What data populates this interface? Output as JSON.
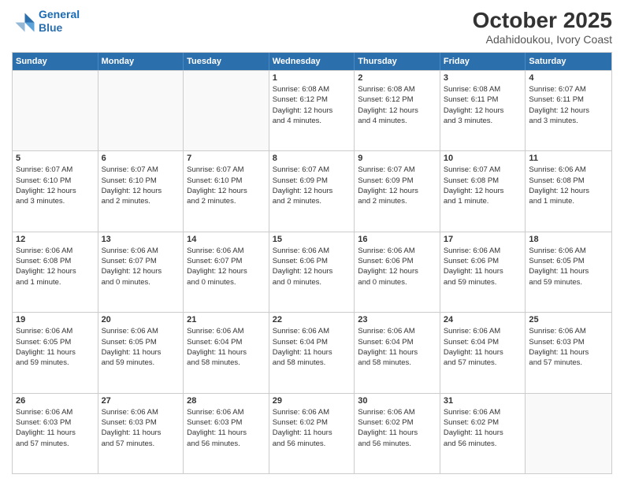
{
  "header": {
    "logo_line1": "General",
    "logo_line2": "Blue",
    "month": "October 2025",
    "location": "Adahidoukou, Ivory Coast"
  },
  "days_of_week": [
    "Sunday",
    "Monday",
    "Tuesday",
    "Wednesday",
    "Thursday",
    "Friday",
    "Saturday"
  ],
  "rows": [
    [
      {
        "day": "",
        "info": [],
        "empty": true
      },
      {
        "day": "",
        "info": [],
        "empty": true
      },
      {
        "day": "",
        "info": [],
        "empty": true
      },
      {
        "day": "1",
        "info": [
          "Sunrise: 6:08 AM",
          "Sunset: 6:12 PM",
          "Daylight: 12 hours",
          "and 4 minutes."
        ],
        "empty": false
      },
      {
        "day": "2",
        "info": [
          "Sunrise: 6:08 AM",
          "Sunset: 6:12 PM",
          "Daylight: 12 hours",
          "and 4 minutes."
        ],
        "empty": false
      },
      {
        "day": "3",
        "info": [
          "Sunrise: 6:08 AM",
          "Sunset: 6:11 PM",
          "Daylight: 12 hours",
          "and 3 minutes."
        ],
        "empty": false
      },
      {
        "day": "4",
        "info": [
          "Sunrise: 6:07 AM",
          "Sunset: 6:11 PM",
          "Daylight: 12 hours",
          "and 3 minutes."
        ],
        "empty": false
      }
    ],
    [
      {
        "day": "5",
        "info": [
          "Sunrise: 6:07 AM",
          "Sunset: 6:10 PM",
          "Daylight: 12 hours",
          "and 3 minutes."
        ],
        "empty": false
      },
      {
        "day": "6",
        "info": [
          "Sunrise: 6:07 AM",
          "Sunset: 6:10 PM",
          "Daylight: 12 hours",
          "and 2 minutes."
        ],
        "empty": false
      },
      {
        "day": "7",
        "info": [
          "Sunrise: 6:07 AM",
          "Sunset: 6:10 PM",
          "Daylight: 12 hours",
          "and 2 minutes."
        ],
        "empty": false
      },
      {
        "day": "8",
        "info": [
          "Sunrise: 6:07 AM",
          "Sunset: 6:09 PM",
          "Daylight: 12 hours",
          "and 2 minutes."
        ],
        "empty": false
      },
      {
        "day": "9",
        "info": [
          "Sunrise: 6:07 AM",
          "Sunset: 6:09 PM",
          "Daylight: 12 hours",
          "and 2 minutes."
        ],
        "empty": false
      },
      {
        "day": "10",
        "info": [
          "Sunrise: 6:07 AM",
          "Sunset: 6:08 PM",
          "Daylight: 12 hours",
          "and 1 minute."
        ],
        "empty": false
      },
      {
        "day": "11",
        "info": [
          "Sunrise: 6:06 AM",
          "Sunset: 6:08 PM",
          "Daylight: 12 hours",
          "and 1 minute."
        ],
        "empty": false
      }
    ],
    [
      {
        "day": "12",
        "info": [
          "Sunrise: 6:06 AM",
          "Sunset: 6:08 PM",
          "Daylight: 12 hours",
          "and 1 minute."
        ],
        "empty": false
      },
      {
        "day": "13",
        "info": [
          "Sunrise: 6:06 AM",
          "Sunset: 6:07 PM",
          "Daylight: 12 hours",
          "and 0 minutes."
        ],
        "empty": false
      },
      {
        "day": "14",
        "info": [
          "Sunrise: 6:06 AM",
          "Sunset: 6:07 PM",
          "Daylight: 12 hours",
          "and 0 minutes."
        ],
        "empty": false
      },
      {
        "day": "15",
        "info": [
          "Sunrise: 6:06 AM",
          "Sunset: 6:06 PM",
          "Daylight: 12 hours",
          "and 0 minutes."
        ],
        "empty": false
      },
      {
        "day": "16",
        "info": [
          "Sunrise: 6:06 AM",
          "Sunset: 6:06 PM",
          "Daylight: 12 hours",
          "and 0 minutes."
        ],
        "empty": false
      },
      {
        "day": "17",
        "info": [
          "Sunrise: 6:06 AM",
          "Sunset: 6:06 PM",
          "Daylight: 11 hours",
          "and 59 minutes."
        ],
        "empty": false
      },
      {
        "day": "18",
        "info": [
          "Sunrise: 6:06 AM",
          "Sunset: 6:05 PM",
          "Daylight: 11 hours",
          "and 59 minutes."
        ],
        "empty": false
      }
    ],
    [
      {
        "day": "19",
        "info": [
          "Sunrise: 6:06 AM",
          "Sunset: 6:05 PM",
          "Daylight: 11 hours",
          "and 59 minutes."
        ],
        "empty": false
      },
      {
        "day": "20",
        "info": [
          "Sunrise: 6:06 AM",
          "Sunset: 6:05 PM",
          "Daylight: 11 hours",
          "and 59 minutes."
        ],
        "empty": false
      },
      {
        "day": "21",
        "info": [
          "Sunrise: 6:06 AM",
          "Sunset: 6:04 PM",
          "Daylight: 11 hours",
          "and 58 minutes."
        ],
        "empty": false
      },
      {
        "day": "22",
        "info": [
          "Sunrise: 6:06 AM",
          "Sunset: 6:04 PM",
          "Daylight: 11 hours",
          "and 58 minutes."
        ],
        "empty": false
      },
      {
        "day": "23",
        "info": [
          "Sunrise: 6:06 AM",
          "Sunset: 6:04 PM",
          "Daylight: 11 hours",
          "and 58 minutes."
        ],
        "empty": false
      },
      {
        "day": "24",
        "info": [
          "Sunrise: 6:06 AM",
          "Sunset: 6:04 PM",
          "Daylight: 11 hours",
          "and 57 minutes."
        ],
        "empty": false
      },
      {
        "day": "25",
        "info": [
          "Sunrise: 6:06 AM",
          "Sunset: 6:03 PM",
          "Daylight: 11 hours",
          "and 57 minutes."
        ],
        "empty": false
      }
    ],
    [
      {
        "day": "26",
        "info": [
          "Sunrise: 6:06 AM",
          "Sunset: 6:03 PM",
          "Daylight: 11 hours",
          "and 57 minutes."
        ],
        "empty": false
      },
      {
        "day": "27",
        "info": [
          "Sunrise: 6:06 AM",
          "Sunset: 6:03 PM",
          "Daylight: 11 hours",
          "and 57 minutes."
        ],
        "empty": false
      },
      {
        "day": "28",
        "info": [
          "Sunrise: 6:06 AM",
          "Sunset: 6:03 PM",
          "Daylight: 11 hours",
          "and 56 minutes."
        ],
        "empty": false
      },
      {
        "day": "29",
        "info": [
          "Sunrise: 6:06 AM",
          "Sunset: 6:02 PM",
          "Daylight: 11 hours",
          "and 56 minutes."
        ],
        "empty": false
      },
      {
        "day": "30",
        "info": [
          "Sunrise: 6:06 AM",
          "Sunset: 6:02 PM",
          "Daylight: 11 hours",
          "and 56 minutes."
        ],
        "empty": false
      },
      {
        "day": "31",
        "info": [
          "Sunrise: 6:06 AM",
          "Sunset: 6:02 PM",
          "Daylight: 11 hours",
          "and 56 minutes."
        ],
        "empty": false
      },
      {
        "day": "",
        "info": [],
        "empty": true
      }
    ]
  ]
}
